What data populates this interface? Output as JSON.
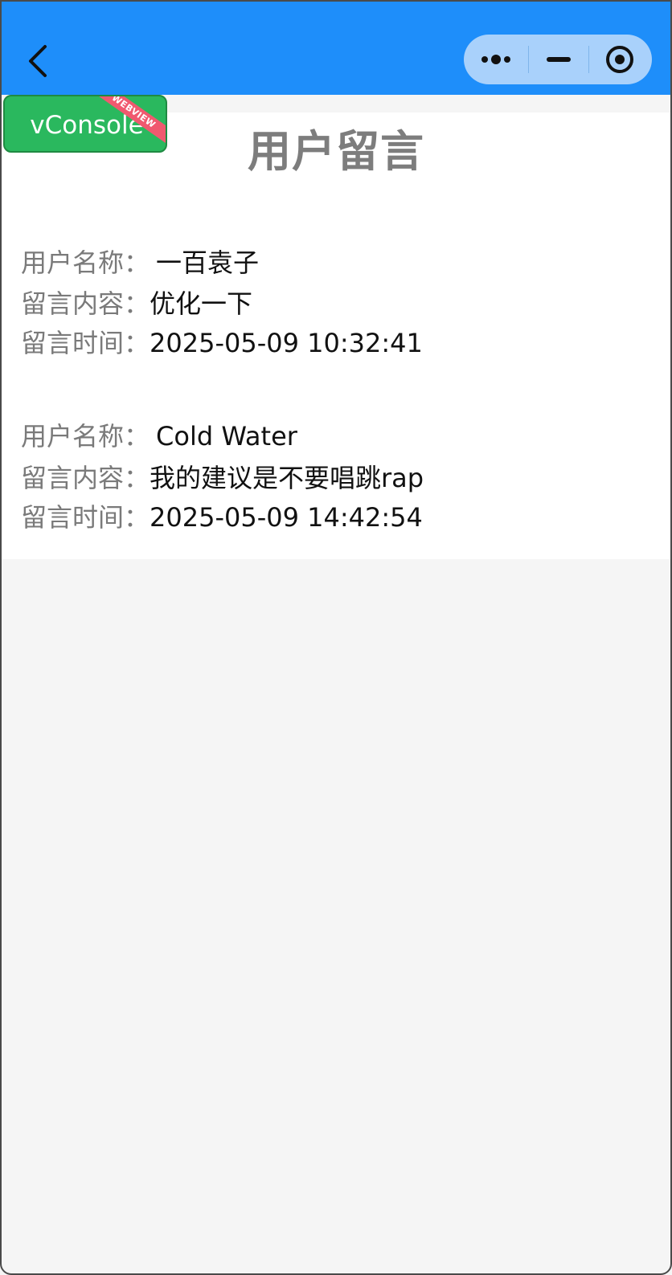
{
  "nav": {
    "back_icon": "chevron-left-icon",
    "capsule_icons": [
      "more-dots-icon",
      "minimize-icon",
      "close-circle-icon"
    ],
    "bar_color": "#1e8efa"
  },
  "vconsole": {
    "label": "vConsole",
    "ribbon": "WEBVIEW"
  },
  "page": {
    "title": "用户留言"
  },
  "messages": [
    {
      "user_label": "用户名称：",
      "user_value": "一百袁子",
      "content_label": "留言内容：",
      "content_value": "优化一下",
      "time_label": "留言时间：",
      "time_value": "2025-05-09 10:32:41"
    },
    {
      "user_label": "用户名称：",
      "user_value": "Cold Water",
      "content_label": "留言内容：",
      "content_value": "我的建议是不要唱跳rap",
      "time_label": "留言时间：",
      "time_value": "2025-05-09 14:42:54"
    }
  ]
}
